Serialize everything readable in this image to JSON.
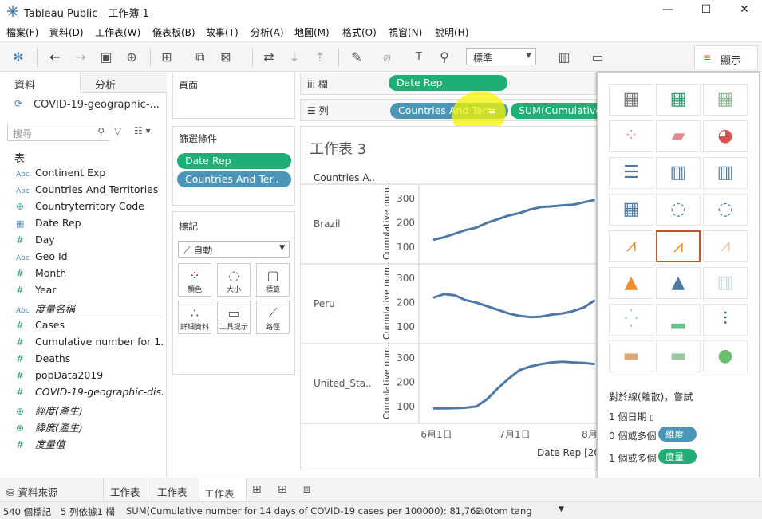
{
  "window": {
    "title": "Tableau Public - 工作簿 1",
    "min": "—",
    "max": "☐",
    "close": "✕"
  },
  "menu": [
    "檔案(F)",
    "資料(D)",
    "工作表(W)",
    "儀表板(B)",
    "故事(T)",
    "分析(A)",
    "地圖(M)",
    "格式(O)",
    "視窗(N)",
    "說明(H)"
  ],
  "toolbar": {
    "fit_dropdown": "標準",
    "show_me": "顯示"
  },
  "left_pane": {
    "tab_data": "資料",
    "tab_analytics": "分析",
    "datasource": "COVID-19-geographic-...",
    "search_placeholder": "搜尋",
    "section_table": "表",
    "fields": [
      {
        "icon": "Abc",
        "name": "Continent Exp"
      },
      {
        "icon": "Abc",
        "name": "Countries And Territories"
      },
      {
        "icon": "⊕",
        "name": "Countryterritory Code"
      },
      {
        "icon": "▦",
        "name": "Date Rep"
      },
      {
        "icon": "#",
        "name": "Day"
      },
      {
        "icon": "Abc",
        "name": "Geo Id"
      },
      {
        "icon": "#",
        "name": "Month"
      },
      {
        "icon": "#",
        "name": "Year"
      },
      {
        "icon": "Abc",
        "name": "度量名稱"
      },
      {
        "icon": "#",
        "name": "Cases"
      },
      {
        "icon": "#",
        "name": "Cumulative number for 1..."
      },
      {
        "icon": "#",
        "name": "Deaths"
      },
      {
        "icon": "#",
        "name": "popData2019"
      },
      {
        "icon": "#",
        "name": "COVID-19-geographic-dis..."
      },
      {
        "icon": "⊕",
        "name": "經度(產生)"
      },
      {
        "icon": "⊕",
        "name": "緯度(產生)"
      },
      {
        "icon": "#",
        "name": "度量值"
      }
    ]
  },
  "shelves": {
    "pages": "頁面",
    "filters": "篩選條件",
    "filter_pills": [
      "Date Rep",
      "Countries And Ter.."
    ],
    "marks": "標記",
    "mark_type": "自動",
    "mark_buttons": [
      "顏色",
      "大小",
      "標籤",
      "詳細資料",
      "工具提示",
      "路徑"
    ],
    "columns_label": "欄",
    "rows_label": "列",
    "columns_pill": "Date Rep",
    "rows_pills": [
      "Countries And Terr..",
      "SUM(Cumulative"
    ]
  },
  "view": {
    "sheet_title": "工作表 3",
    "header": "Countries A..",
    "x_axis_title": "Date Rep [202",
    "y_axis_title": "Cumulative num.."
  },
  "chart_data": {
    "type": "line",
    "x_ticks": [
      "6月1日",
      "7月1日",
      "8月"
    ],
    "y_ticks": [
      100,
      200,
      300
    ],
    "series": [
      {
        "name": "Brazil",
        "values": [
          130,
          140,
          155,
          170,
          180,
          200,
          215,
          230,
          240,
          255,
          265,
          268,
          272,
          275,
          285,
          295
        ]
      },
      {
        "name": "Peru",
        "values": [
          220,
          235,
          230,
          210,
          200,
          185,
          170,
          155,
          145,
          140,
          142,
          150,
          155,
          165,
          180,
          210
        ]
      },
      {
        "name": "United_Sta..",
        "values": [
          92,
          92,
          93,
          95,
          100,
          130,
          175,
          215,
          250,
          265,
          275,
          282,
          285,
          282,
          280,
          275
        ]
      }
    ]
  },
  "show_me": {
    "hint_title": "對於線(離散)，嘗試",
    "req1": "1 個日期",
    "req2_prefix": "0 個或多個",
    "req2_pill": "維度",
    "req3_prefix": "1 個或多個",
    "req3_pill": "度量"
  },
  "bottom_tabs": {
    "datasource": "資料來源",
    "sheets": [
      "工作表 1",
      "工作表 2",
      "工作表 3"
    ]
  },
  "status": {
    "marks": "540 個標記",
    "rows_cols": "5 列依據1 欄",
    "sum": "SUM(Cumulative number for 14 days of COVID-19 cases per 100000): 81,762.0",
    "user": "tom tang"
  },
  "colors": {
    "green": "#1fae74",
    "blue": "#4a95b8",
    "line": "#4e79a7",
    "highlight": "#f5f500"
  }
}
